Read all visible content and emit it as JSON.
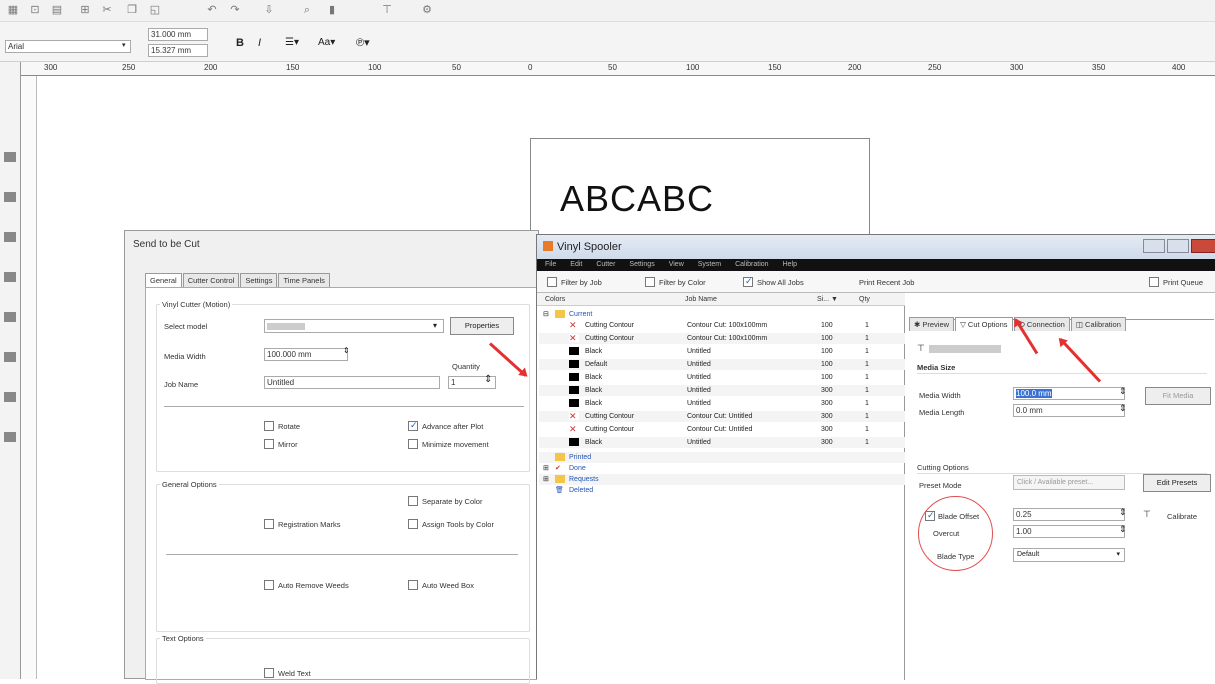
{
  "font": {
    "name": "Arial"
  },
  "size": {
    "width": "31.000 mm",
    "height": "15.327 mm"
  },
  "ruler": {
    "marks": [
      "300",
      "250",
      "200",
      "150",
      "100",
      "50",
      "0",
      "50",
      "100",
      "150",
      "200",
      "250",
      "300",
      "350",
      "400"
    ]
  },
  "canvas": {
    "text": "ABCABC"
  },
  "cut_dialog": {
    "title": "Send to be Cut",
    "tabs": [
      "General",
      "Cutter Control",
      "Settings",
      "Time Panels"
    ],
    "vinyl_group": "Vinyl Cutter (Motion)",
    "select_model_label": "Select model",
    "properties_button": "Properties",
    "media_width_label": "Media Width",
    "media_width_value": "100.000 mm",
    "quantity_label": "Quantity",
    "quantity_value": "1",
    "job_name_label": "Job Name",
    "job_name_value": "Untitled",
    "rotate": "Rotate",
    "mirror": "Mirror",
    "advance_after_plot": "Advance after Plot",
    "minimize_movement": "Minimize movement",
    "general_options": "General Options",
    "separate_by_color": "Separate by Color",
    "registration_marks": "Registration Marks",
    "assign_tools_by_color": "Assign Tools by Color",
    "auto_remove_weeds": "Auto Remove Weeds",
    "auto_weed_box": "Auto Weed Box",
    "text_options": "Text Options",
    "weld_text": "Weld Text"
  },
  "spooler": {
    "title": "Vinyl Spooler",
    "menu": [
      "File",
      "Edit",
      "Cutter",
      "Settings",
      "View",
      "System",
      "Calibration",
      "Help"
    ],
    "filters": {
      "by_job": "Filter by Job",
      "by_color": "Filter by Color",
      "show_all": "Show All Jobs",
      "print_recent": "Print Recent Job",
      "print_queue": "Print Queue"
    },
    "columns": {
      "colors": "Colors",
      "job_name": "Job Name",
      "size": "Si... ▼",
      "qty": "Qty"
    },
    "tree": {
      "current": "Current",
      "printed": "Printed",
      "done": "Done",
      "requests": "Requests",
      "deleted": "Deleted"
    },
    "rows": [
      {
        "color": "Cutting Contour",
        "job": "Contour Cut: 100x100mm",
        "size": "100",
        "qty": "1"
      },
      {
        "color": "Cutting Contour",
        "job": "Contour Cut: 100x100mm",
        "size": "100",
        "qty": "1"
      },
      {
        "color": "Black",
        "job": "Untitled",
        "size": "100",
        "qty": "1"
      },
      {
        "color": "Default",
        "job": "Untitled",
        "size": "100",
        "qty": "1"
      },
      {
        "color": "Black",
        "job": "Untitled",
        "size": "100",
        "qty": "1"
      },
      {
        "color": "Black",
        "job": "Untitled",
        "size": "300",
        "qty": "1"
      },
      {
        "color": "Black",
        "job": "Untitled",
        "size": "300",
        "qty": "1"
      },
      {
        "color": "Cutting Contour",
        "job": "Contour Cut: Untitled",
        "size": "300",
        "qty": "1"
      },
      {
        "color": "Cutting Contour",
        "job": "Contour Cut: Untitled",
        "size": "300",
        "qty": "1"
      },
      {
        "color": "Black",
        "job": "Untitled",
        "size": "300",
        "qty": "1"
      }
    ],
    "tabs": [
      "Preview",
      "Cut Options",
      "Connection",
      "Calibration"
    ],
    "media_size": "Media Size",
    "media_width_label": "Media Width",
    "media_width_value": "100.0 mm",
    "media_length_label": "Media Length",
    "media_length_value": "0.0 mm",
    "fit_media": "Fit Media",
    "cutting_options": "Cutting Options",
    "preset_mode_label": "Preset Mode",
    "preset_mode_value": "Click / Available preset...",
    "edit_presets": "Edit Presets",
    "blade_offset": "Blade Offset",
    "blade_offset_value": "0.25",
    "overcut": "Overcut",
    "overcut_value": "1.00",
    "calibrate": "Calibrate",
    "blade_type_label": "Blade Type",
    "blade_type_value": "Default"
  }
}
